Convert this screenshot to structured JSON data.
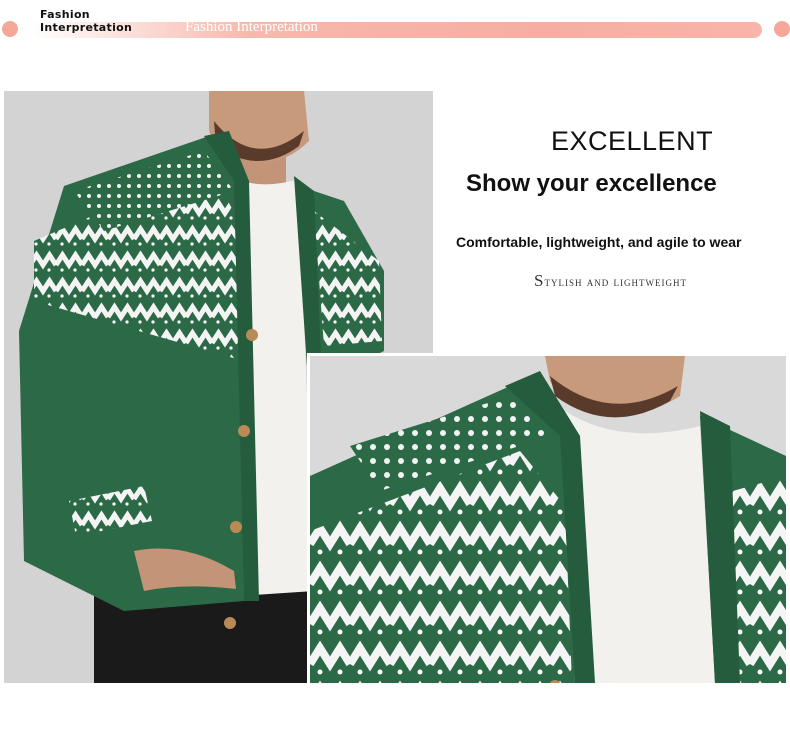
{
  "banner": {
    "brand_line1": "Fashion",
    "brand_line2": "Interpretation",
    "bar_title": "Fashion Interpretation",
    "accent_color": "#f5a79a"
  },
  "copy": {
    "headline": "EXCELLENT",
    "subhead": "Show your excellence",
    "feature": "Comfortable, lightweight, and agile to wear",
    "tagline": "Stylish and lightweight"
  },
  "images": [
    {
      "name": "model-full-cardigan-photo",
      "colors": {
        "knit": "#2c6a47",
        "pattern": "#ffffff",
        "tee": "#f2f1ee",
        "backdrop": "#d9d9d9"
      }
    },
    {
      "name": "model-closeup-cardigan-photo",
      "colors": {
        "knit": "#2c6a47",
        "pattern": "#ffffff",
        "tee": "#f2f1ee",
        "backdrop": "#d9d9d9"
      }
    }
  ]
}
